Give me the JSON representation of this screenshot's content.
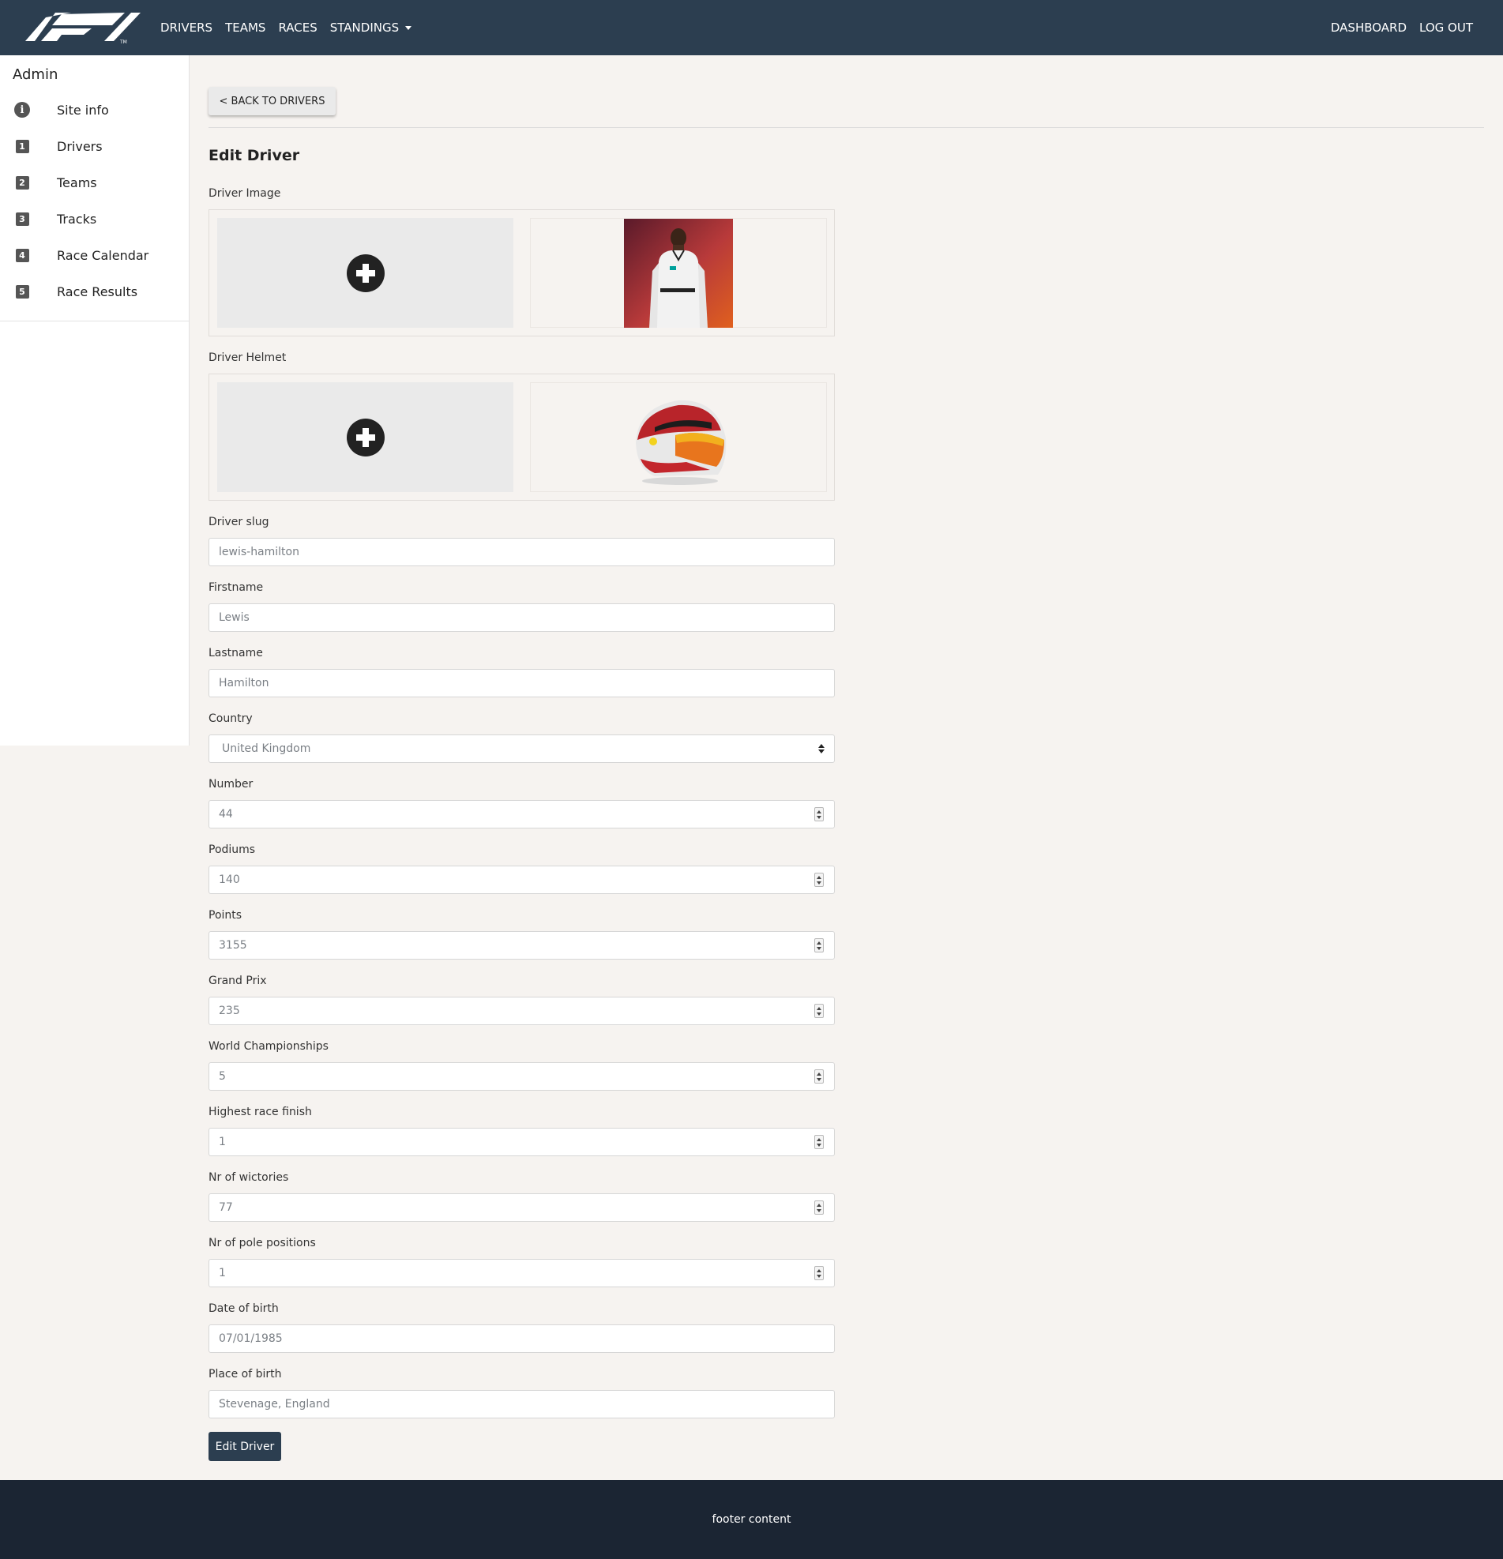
{
  "navbar": {
    "links": [
      "DRIVERS",
      "TEAMS",
      "RACES",
      "STANDINGS"
    ],
    "right_links": [
      "DASHBOARD",
      "LOG OUT"
    ]
  },
  "sidebar": {
    "title": "Admin",
    "items": [
      {
        "icon": "i",
        "icon_name": "info-icon",
        "label": "Site info"
      },
      {
        "icon": "1",
        "icon_name": "number-1-icon",
        "label": "Drivers"
      },
      {
        "icon": "2",
        "icon_name": "number-2-icon",
        "label": "Teams"
      },
      {
        "icon": "3",
        "icon_name": "number-3-icon",
        "label": "Tracks"
      },
      {
        "icon": "4",
        "icon_name": "number-4-icon",
        "label": "Race Calendar"
      },
      {
        "icon": "5",
        "icon_name": "number-5-icon",
        "label": "Race Results"
      }
    ]
  },
  "main": {
    "back_button": "< BACK TO DRIVERS",
    "title": "Edit Driver",
    "driver_image": {
      "label": "Driver Image",
      "upload_icon": "plus-circle-icon"
    },
    "driver_helmet": {
      "label": "Driver Helmet",
      "upload_icon": "plus-circle-icon"
    },
    "fields": {
      "slug": {
        "label": "Driver slug",
        "value": "lewis-hamilton"
      },
      "firstname": {
        "label": "Firstname",
        "value": "Lewis"
      },
      "lastname": {
        "label": "Lastname",
        "value": "Hamilton"
      },
      "country": {
        "label": "Country",
        "value": "United Kingdom"
      },
      "number": {
        "label": "Number",
        "value": "44"
      },
      "podiums": {
        "label": "Podiums",
        "value": "140"
      },
      "points": {
        "label": "Points",
        "value": "3155"
      },
      "grand_prix": {
        "label": "Grand Prix",
        "value": "235"
      },
      "world_championships": {
        "label": "World Championships",
        "value": "5"
      },
      "highest_race_finish": {
        "label": "Highest race finish",
        "value": "1"
      },
      "victories": {
        "label": "Nr of wictories",
        "value": "77"
      },
      "pole_positions": {
        "label": "Nr of pole positions",
        "value": "1"
      },
      "date_of_birth": {
        "label": "Date of birth",
        "value": "07/01/1985"
      },
      "place_of_birth": {
        "label": "Place of birth",
        "value": "Stevenage, England"
      }
    },
    "submit_button": "Edit Driver"
  },
  "footer": {
    "text": "footer content"
  },
  "colors": {
    "navbar": "#2c3e50",
    "footer": "#1b2533",
    "page": "#f6f3f0",
    "button": "#2c3e50"
  }
}
